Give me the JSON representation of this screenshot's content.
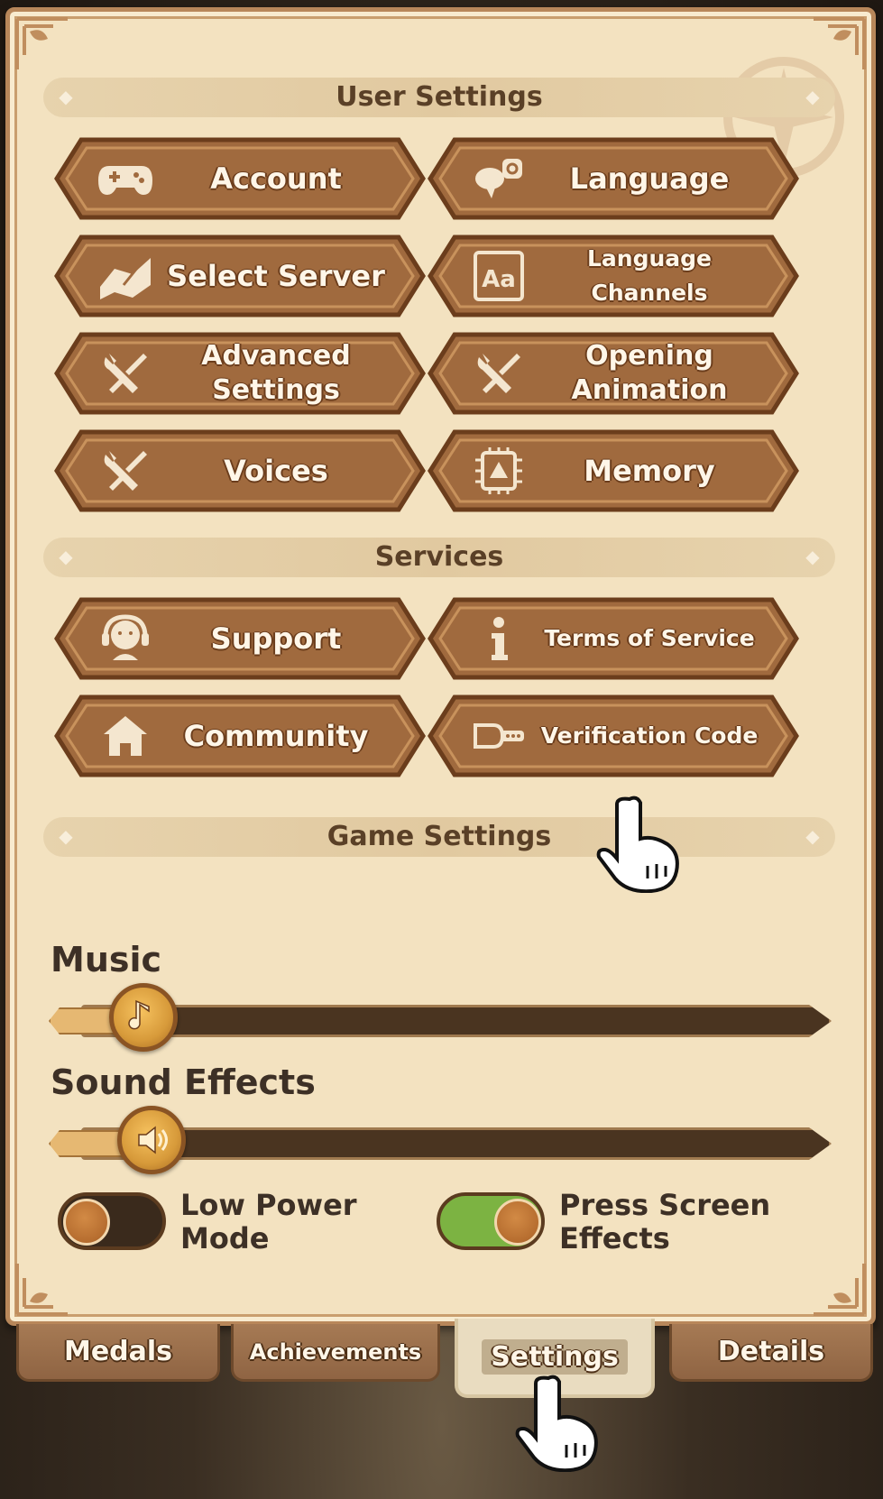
{
  "sections": {
    "user_settings": "User Settings",
    "services": "Services",
    "game_settings": "Game Settings"
  },
  "buttons": {
    "account": {
      "label": "Account",
      "icon": "gamepad-icon"
    },
    "language": {
      "label": "Language",
      "icon": "language-speech-icon"
    },
    "select_server": {
      "label": "Select Server",
      "icon": "map-icon"
    },
    "language_channels": {
      "label": "Language Channels",
      "icon": "text-aa-icon"
    },
    "advanced_settings": {
      "label": "Advanced Settings",
      "icon": "wrench-screwdriver-icon"
    },
    "opening_animation": {
      "label": "Opening Animation",
      "icon": "wrench-screwdriver-icon"
    },
    "voices": {
      "label": "Voices",
      "icon": "wrench-screwdriver-icon"
    },
    "memory": {
      "label": "Memory",
      "icon": "chip-icon"
    },
    "support": {
      "label": "Support",
      "icon": "headset-icon"
    },
    "terms_of_service": {
      "label": "Terms of Service",
      "icon": "info-icon"
    },
    "community": {
      "label": "Community",
      "icon": "home-icon"
    },
    "verification_code": {
      "label": "Verification Code",
      "icon": "key-icon"
    }
  },
  "game_settings": {
    "music_label": "Music",
    "music_level": 0.05,
    "sound_effects_label": "Sound Effects",
    "sound_effects_level": 0.06,
    "low_power_mode_label": "Low Power Mode",
    "low_power_mode_on": false,
    "press_screen_effects_label": "Press Screen Effects",
    "press_screen_effects_on": true
  },
  "tabs": [
    "Medals",
    "Achievements",
    "Settings",
    "Details"
  ],
  "active_tab": "Settings",
  "colors": {
    "panel_bg": "#f3e2c0",
    "button_brown": "#a06a3e",
    "toggle_on_green": "#7cb342",
    "label_dark": "#3d3026"
  }
}
